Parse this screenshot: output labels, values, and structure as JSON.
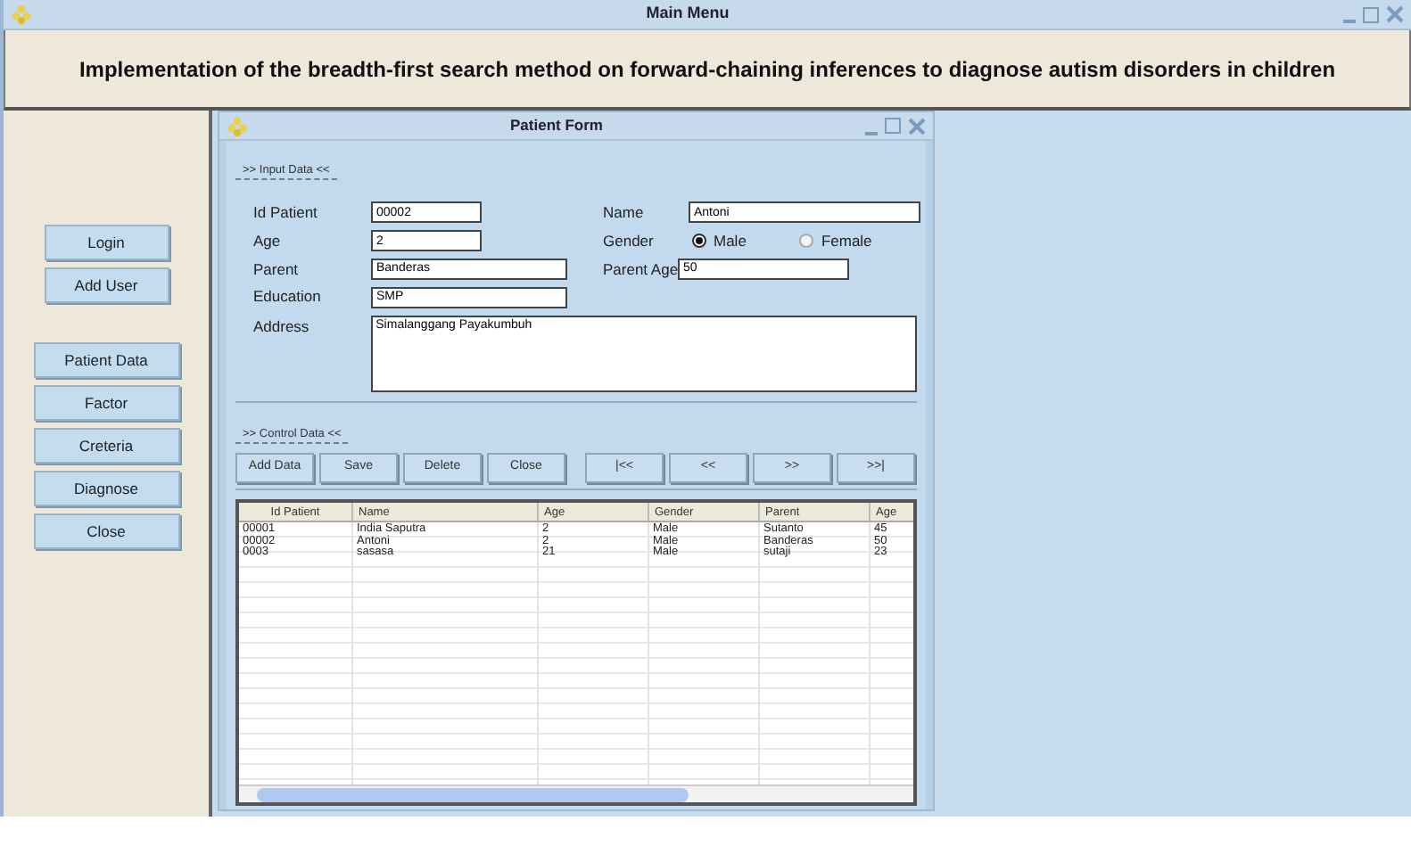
{
  "window": {
    "title": "Main Menu"
  },
  "header": {
    "title": "Implementation of the breadth-first search method on forward-chaining inferences to diagnose autism disorders in children"
  },
  "sidebar": {
    "groups": [
      [
        "Login",
        "Add User"
      ],
      [
        "Patient Data",
        "Factor",
        "Creteria",
        "Diagnose",
        "Close"
      ]
    ]
  },
  "patient_form": {
    "title": "Patient Form",
    "input_group": {
      "legend": ">> Input Data <<",
      "fields": [
        {
          "label": "Id Patient",
          "value": "00002"
        },
        {
          "label": "Name",
          "value": "Antoni"
        },
        {
          "label": "Age",
          "value": "2"
        },
        {
          "label": "Parent",
          "value": "Banderas"
        },
        {
          "label": "Parent Age",
          "value": "50"
        },
        {
          "label": "Education",
          "value": "SMP"
        },
        {
          "label": "Address",
          "value": "Simalanggang Payakumbuh"
        }
      ],
      "gender": {
        "label": "Gender",
        "options": [
          {
            "label": "Male",
            "selected": true
          },
          {
            "label": "Female",
            "selected": false
          }
        ]
      }
    },
    "control_group": {
      "legend": ">> Control Data <<",
      "buttons": [
        "Add Data",
        "Save",
        "Delete",
        "Close",
        "|<<",
        "<<",
        ">>",
        ">>|"
      ]
    },
    "table": {
      "columns": [
        "Id Patient",
        "Name",
        "Age",
        "Gender",
        "Parent",
        "Age"
      ],
      "rows": [
        [
          "00001",
          "India Saputra",
          "2",
          "Male",
          "Sutanto",
          "45"
        ],
        [
          "00002",
          "Antoni",
          "2",
          "Male",
          "Banderas",
          "50"
        ],
        [
          "0003",
          "sasasa",
          "21",
          "Male",
          "sutaji",
          "23"
        ]
      ]
    }
  }
}
